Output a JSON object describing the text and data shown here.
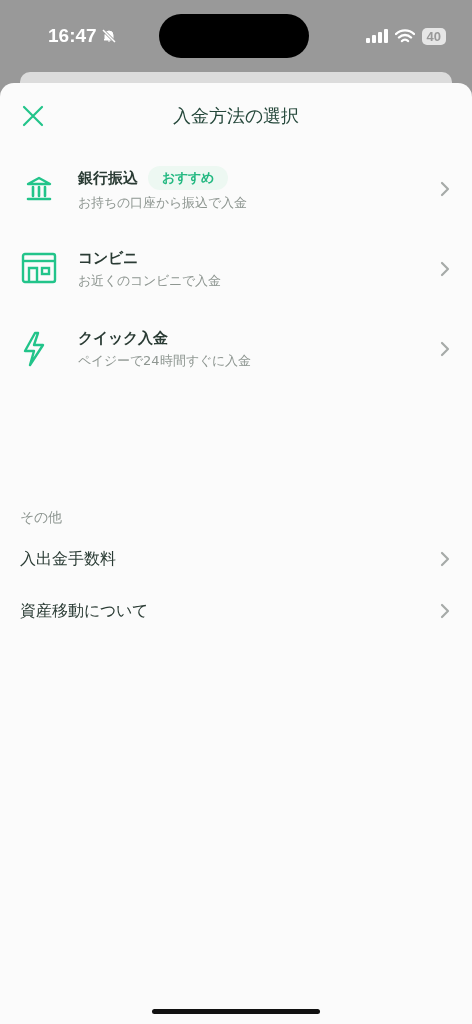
{
  "status_bar": {
    "time": "16:47",
    "battery": "40"
  },
  "sheet": {
    "title": "入金方法の選択"
  },
  "methods": [
    {
      "kind": "bank",
      "title": "銀行振込",
      "badge": "おすすめ",
      "subtitle": "お持ちの口座から振込で入金"
    },
    {
      "kind": "store",
      "title": "コンビニ",
      "subtitle": "お近くのコンビニで入金"
    },
    {
      "kind": "bolt",
      "title": "クイック入金",
      "subtitle": "ペイジーで24時間すぐに入金"
    }
  ],
  "other": {
    "heading": "その他",
    "items": [
      {
        "label": "入出金手数料"
      },
      {
        "label": "資産移動について"
      }
    ]
  }
}
